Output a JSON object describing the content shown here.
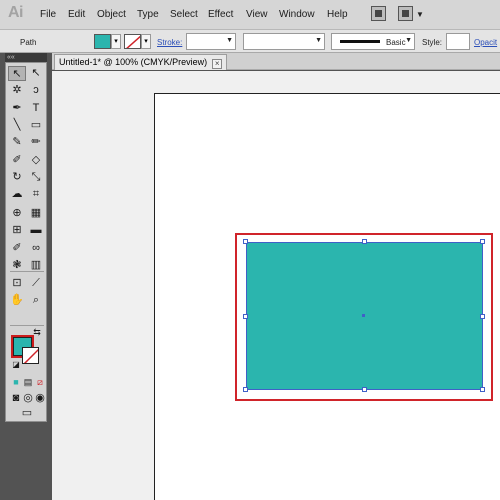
{
  "app": {
    "logo": "Ai"
  },
  "menu": [
    "File",
    "Edit",
    "Object",
    "Type",
    "Select",
    "Effect",
    "View",
    "Window",
    "Help"
  ],
  "control_bar": {
    "selection_label": "Path",
    "fill_color": "#2bb5ae",
    "stroke_label": "Stroke:",
    "brush_label": "Basic",
    "style_label": "Style:",
    "opacity_label": "Opacit"
  },
  "document_tab": {
    "title": "Untitled-1* @ 100% (CMYK/Preview)",
    "close_glyph": "×"
  },
  "toolbox": {
    "collapse_glyph": "««",
    "fill_color": "#2bb5ae",
    "tools": [
      {
        "name": "selection-tool",
        "glyph": "↖",
        "active": true
      },
      {
        "name": "direct-selection-tool",
        "glyph": "↖"
      },
      {
        "name": "magic-wand-tool",
        "glyph": "✲"
      },
      {
        "name": "lasso-tool",
        "glyph": "ↄ"
      },
      {
        "name": "pen-tool",
        "glyph": "✒"
      },
      {
        "name": "type-tool",
        "glyph": "T"
      },
      {
        "name": "line-segment-tool",
        "glyph": "╲"
      },
      {
        "name": "rectangle-tool",
        "glyph": "▭"
      },
      {
        "name": "paintbrush-tool",
        "glyph": "✎"
      },
      {
        "name": "pencil-tool",
        "glyph": "✏"
      },
      {
        "name": "blob-brush-tool",
        "glyph": "✐"
      },
      {
        "name": "eraser-tool",
        "glyph": "◇"
      },
      {
        "name": "rotate-tool",
        "glyph": "↻"
      },
      {
        "name": "scale-tool",
        "glyph": "⤡"
      },
      {
        "name": "warp-tool",
        "glyph": "☁"
      },
      {
        "name": "free-transform-tool",
        "glyph": "⌗"
      },
      {
        "name": "shape-builder-tool",
        "glyph": "⊕"
      },
      {
        "name": "perspective-grid-tool",
        "glyph": "▦"
      },
      {
        "name": "mesh-tool",
        "glyph": "⊞"
      },
      {
        "name": "gradient-tool",
        "glyph": "▬"
      },
      {
        "name": "eyedropper-tool",
        "glyph": "✐"
      },
      {
        "name": "blend-tool",
        "glyph": "∞"
      },
      {
        "name": "symbol-sprayer-tool",
        "glyph": "❃"
      },
      {
        "name": "column-graph-tool",
        "glyph": "▥"
      },
      {
        "name": "artboard-tool",
        "glyph": "⊡"
      },
      {
        "name": "slice-tool",
        "glyph": "⟋"
      },
      {
        "name": "hand-tool",
        "glyph": "✋"
      },
      {
        "name": "zoom-tool",
        "glyph": "⌕"
      }
    ]
  }
}
